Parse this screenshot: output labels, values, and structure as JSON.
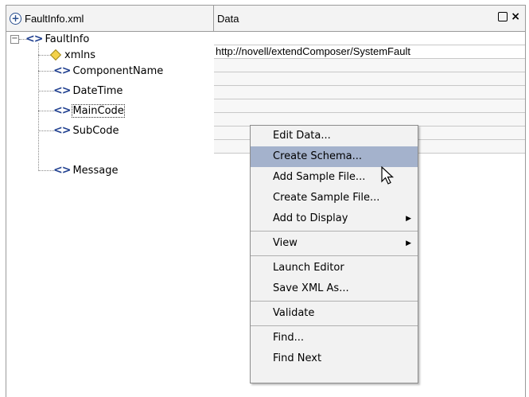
{
  "header": {
    "file_name": "FaultInfo.xml",
    "data_column": "Data"
  },
  "tree": {
    "root": "FaultInfo",
    "attribute": "xmlns",
    "children": [
      "ComponentName",
      "DateTime",
      "MainCode",
      "SubCode",
      "Message"
    ]
  },
  "data": {
    "xmlns_value": "http://novell/extendComposer/SystemFault"
  },
  "menu": {
    "items": [
      {
        "label": "Edit Data..."
      },
      {
        "label": "Create Schema...",
        "highlighted": true
      },
      {
        "label": "Add Sample File..."
      },
      {
        "label": "Create Sample File..."
      },
      {
        "label": "Add to Display",
        "submenu": true
      },
      {
        "label": "View",
        "submenu": true
      },
      {
        "label": "Launch Editor"
      },
      {
        "label": "Save XML As..."
      },
      {
        "label": "Validate"
      },
      {
        "label": "Find..."
      },
      {
        "label": "Find Next"
      }
    ]
  },
  "icons": {
    "element_glyph": "<>",
    "collapse_glyph": "−"
  },
  "colors": {
    "element_icon": "#1f3f8f",
    "attribute_icon": "#f4d24a",
    "menu_highlight": "#a4b2cc"
  }
}
